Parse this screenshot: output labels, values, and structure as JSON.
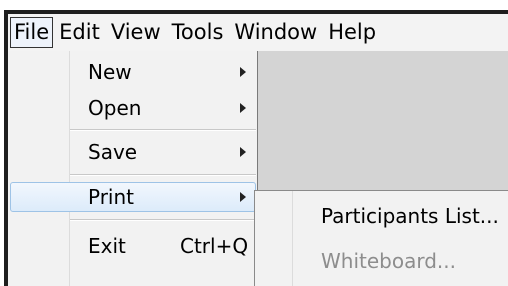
{
  "menubar": {
    "items": [
      "File",
      "Edit",
      "View",
      "Tools",
      "Window",
      "Help"
    ]
  },
  "file_menu": {
    "new": "New",
    "open": "Open",
    "save": "Save",
    "print": "Print",
    "exit": "Exit",
    "exit_shortcut": "Ctrl+Q"
  },
  "print_submenu": {
    "participants_list": "Participants List...",
    "whiteboard": "Whiteboard..."
  },
  "colors": {
    "menu_background": "#f2f2f2",
    "app_background": "#d4d4d4",
    "highlight_border": "#9ec3e6",
    "disabled_text": "#8d8d8d"
  }
}
